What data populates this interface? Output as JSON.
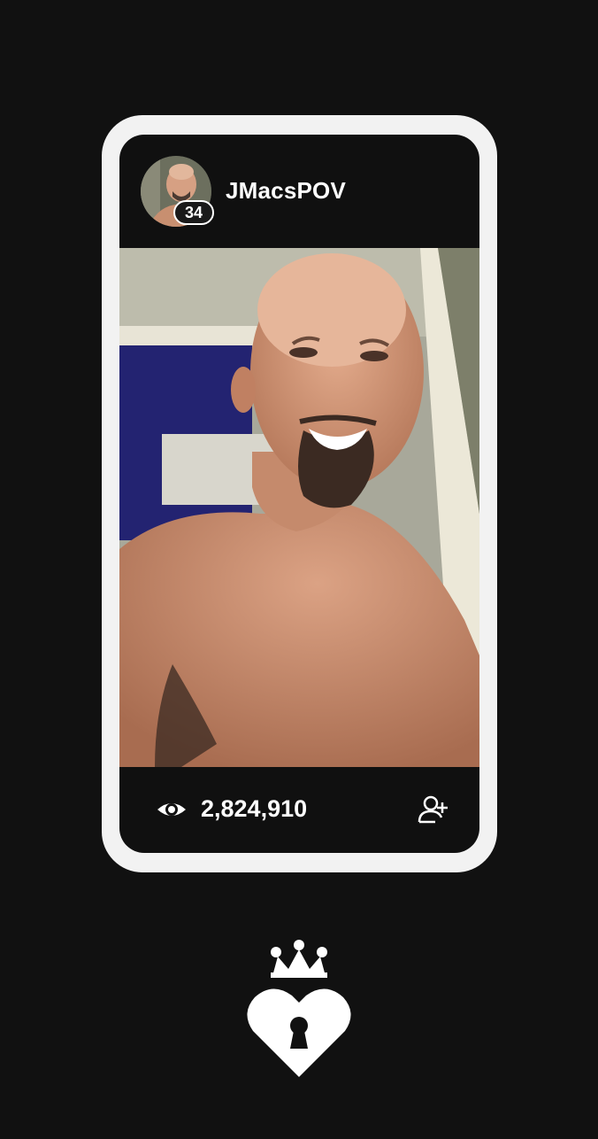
{
  "profile": {
    "username": "JMacsPOV",
    "badge_count": "34",
    "avatar_icon": "person-avatar"
  },
  "stats": {
    "views": "2,824,910",
    "views_icon": "eye-icon",
    "follow_icon": "add-user-icon"
  },
  "brand": {
    "logo_icon": "crowned-heart-keyhole-icon"
  },
  "colors": {
    "background": "#111111",
    "frame": "#f2f2f2",
    "screen": "#101010",
    "text": "#ffffff"
  }
}
